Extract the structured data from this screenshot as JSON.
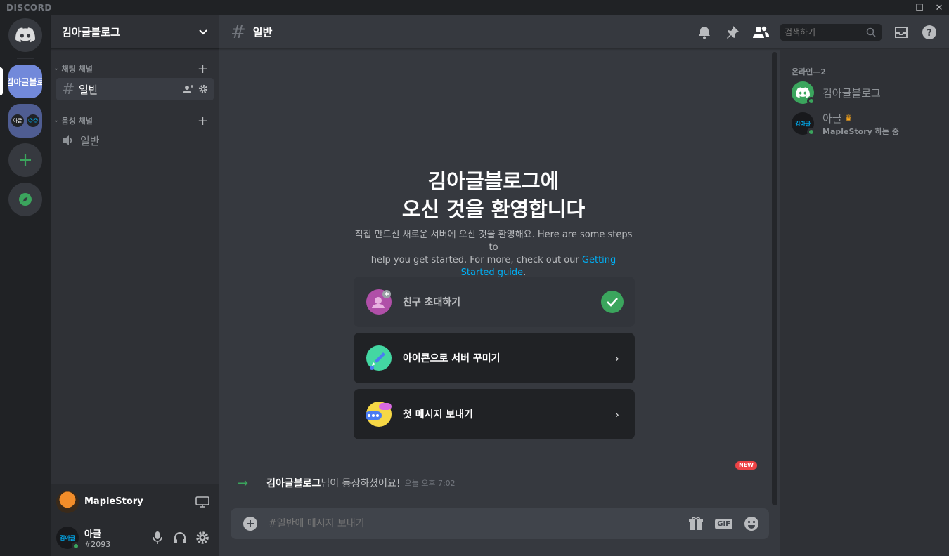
{
  "app": {
    "brand": "DISCORD"
  },
  "window": {
    "minimize": "—",
    "maximize": "☐",
    "close": "✕"
  },
  "guilds": {
    "server1_label": "김아글블로",
    "server2_label_a": "아글",
    "server2_label_b": "☺☺"
  },
  "sidebar": {
    "server_name": "김아글블로그",
    "categories": [
      {
        "name": "채팅 채널"
      },
      {
        "name": "음성 채널"
      }
    ],
    "channels": [
      {
        "name": "일반",
        "type": "text"
      },
      {
        "name": "일반",
        "type": "voice"
      }
    ],
    "activity": {
      "game": "MapleStory"
    },
    "user": {
      "name": "아글",
      "tag": "#2093",
      "avatar_text": "김아글"
    }
  },
  "header": {
    "channel_name": "일반",
    "search_placeholder": "검색하기"
  },
  "welcome": {
    "title_line1": "김아글블로그에",
    "title_line2": "오신 것을 환영합니다",
    "sub_line1": "직접 만드신 새로운 서버에 오신 것을 환영해요. Here are some steps to",
    "sub_line2_prefix": "help you get started. For more, check out our ",
    "sub_link": "Getting Started guide",
    "sub_line2_suffix": ".",
    "cards": [
      {
        "label": "친구 초대하기",
        "done": true
      },
      {
        "label": "아이콘으로 서버 꾸미기",
        "done": false
      },
      {
        "label": "첫 메시지 보내기",
        "done": false
      }
    ]
  },
  "messages": {
    "new_badge": "NEW",
    "join_author": "김아글블로그",
    "join_text": " 님이 등장하셨어요!",
    "join_time": "오늘 오후 7:02"
  },
  "composer": {
    "placeholder": "#일반에 메시지 보내기",
    "gif": "GIF"
  },
  "members": {
    "heading": "온라인—2",
    "list": [
      {
        "name": "김아글블로그",
        "status": ""
      },
      {
        "name": "아글",
        "status": "MapleStory 하는 중",
        "avatar_text": "김아글"
      }
    ]
  },
  "colors": {
    "blurple": "#5865f2",
    "green": "#3ba55d",
    "link": "#00aff4",
    "red": "#ed4245"
  }
}
